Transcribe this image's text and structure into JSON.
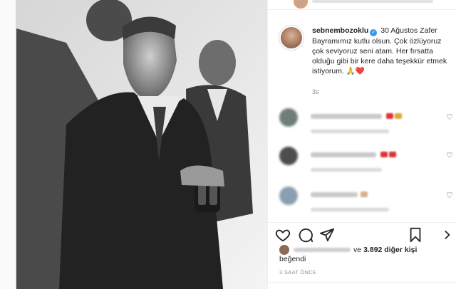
{
  "post": {
    "username": "sebnembozoklu",
    "verified_icon": "verified-badge-icon",
    "caption": "30 Ağustos Zafer Bayramımız kutlu olsun. Çok özlüyoruz çok seviyoruz seni atam. Her fırsatta olduğu gibi bir kere daha teşekkür etmek istiyorum. 🙏❤️",
    "caption_time": "3s",
    "likes_suffix": "ve",
    "likes_count_text": "3.892 diğer kişi",
    "likes_line2": "beğendi",
    "date": "3 SAAT ÖNCE"
  },
  "colors": {
    "link_blue": "#3897f0",
    "text": "#262626",
    "muted": "#8e8e8e",
    "heart_red": "#ed4956"
  },
  "icons": {
    "like": "heart-outline-icon",
    "comment": "comment-bubble-icon",
    "share": "paper-plane-icon",
    "save": "bookmark-icon",
    "comment_like": "heart-outline-icon"
  }
}
